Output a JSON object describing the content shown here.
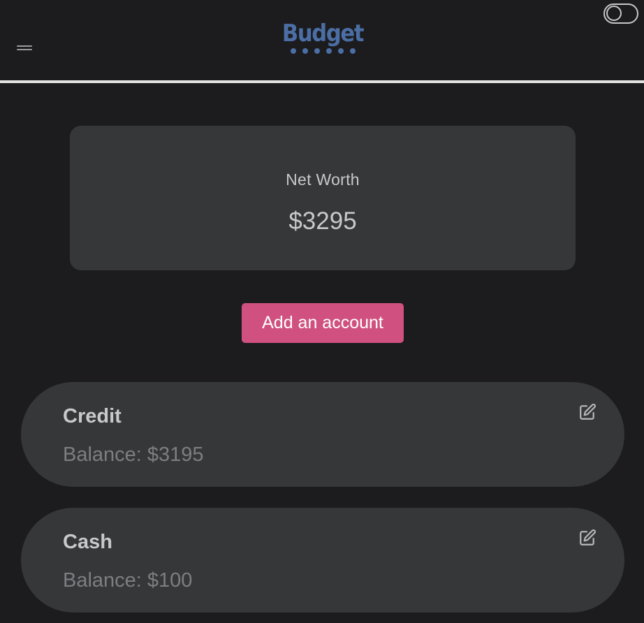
{
  "header": {
    "logo_text": "Budget",
    "logo_dot_count": 6,
    "icons": {
      "menu": "hamburger-menu-icon",
      "theme": "theme-toggle-icon"
    }
  },
  "summary": {
    "label": "Net Worth",
    "value": "$3295"
  },
  "actions": {
    "add_account_label": "Add an account"
  },
  "accounts": [
    {
      "name": "Credit",
      "balance_text": "Balance: $3195",
      "edit_icon": "edit-icon"
    },
    {
      "name": "Cash",
      "balance_text": "Balance: $100",
      "edit_icon": "edit-icon"
    }
  ],
  "colors": {
    "background": "#1c1c1f",
    "card": "#353739",
    "accent_button": "#d0517f",
    "logo": "#4b6ea4",
    "text_primary": "#c8c9cb",
    "text_muted": "#7c7e81"
  }
}
